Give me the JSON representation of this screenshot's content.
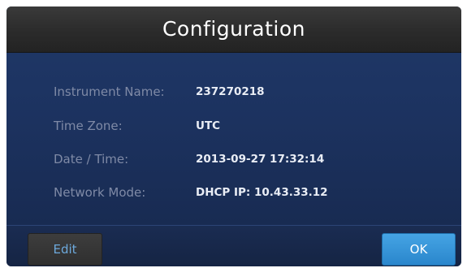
{
  "window": {
    "title": "Configuration"
  },
  "fields": [
    {
      "label": "Instrument Name:",
      "value": "237270218"
    },
    {
      "label": "Time Zone:",
      "value": "UTC"
    },
    {
      "label": "Date / Time:",
      "value": "2013-09-27 17:32:14"
    },
    {
      "label": "Network Mode:",
      "value": "DHCP IP: 10.43.33.12"
    }
  ],
  "footer": {
    "edit_label": "Edit",
    "ok_label": "OK"
  },
  "colors": {
    "title_bar": "#2b2b2b",
    "content_bg": "#1c325f",
    "label_text": "#7f8aa6",
    "value_text": "#e9edf5",
    "edit_text": "#6da9dc",
    "ok_button": "#3696d9"
  }
}
